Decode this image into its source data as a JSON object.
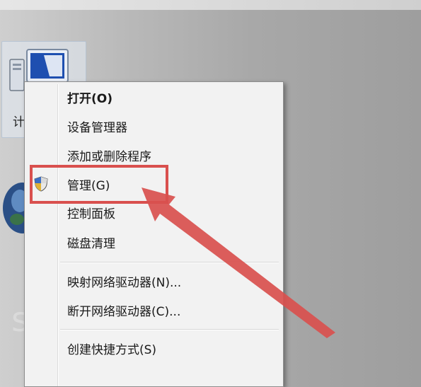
{
  "desktop": {
    "icon_label": "计",
    "watermark": "sfjy"
  },
  "context_menu": {
    "items": [
      {
        "label": "打开(O)",
        "bold": true
      },
      {
        "label": "设备管理器"
      },
      {
        "label": "添加或删除程序"
      },
      {
        "label": "管理(G)",
        "icon": "shield-icon",
        "highlighted": true
      },
      {
        "label": "控制面板"
      },
      {
        "label": "磁盘清理"
      },
      {
        "label": "映射网络驱动器(N)..."
      },
      {
        "label": "断开网络驱动器(C)..."
      },
      {
        "label": "创建快捷方式(S)"
      }
    ]
  },
  "annotation": {
    "highlight_color": "#d9504e",
    "target": "管理(G)"
  }
}
